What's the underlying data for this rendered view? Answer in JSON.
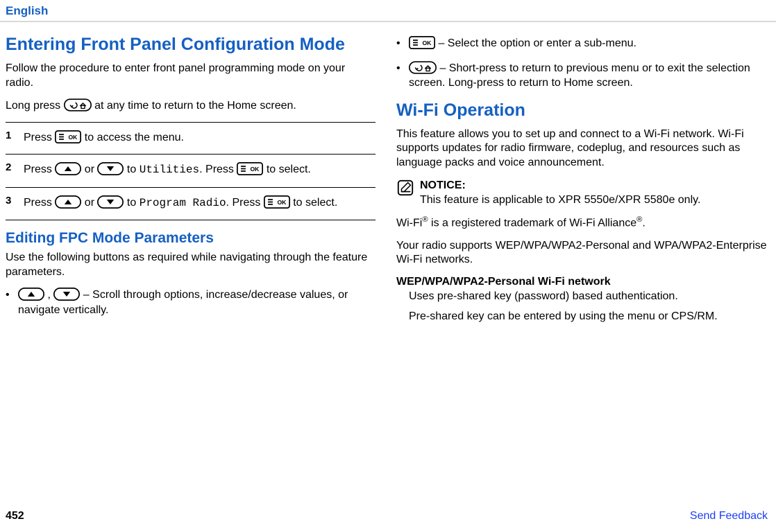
{
  "header": {
    "lang": "English"
  },
  "left": {
    "h1": "Entering Front Panel Configuration Mode",
    "intro": "Follow the procedure to enter front panel programming mode on your radio.",
    "longpress_a": "Long press ",
    "longpress_b": " at any time to return to the Home screen.",
    "steps": [
      {
        "n": "1",
        "a": "Press ",
        "b": " to access the menu."
      },
      {
        "n": "2",
        "a": "Press ",
        "mid": " or ",
        "c": " to ",
        "target": "Utilities",
        "d": ". Press ",
        "e": " to select."
      },
      {
        "n": "3",
        "a": "Press ",
        "mid": " or ",
        "c": " to ",
        "target": "Program Radio",
        "d": ". Press ",
        "e": " to select."
      }
    ],
    "h2": "Editing FPC Mode Parameters",
    "p2": "Use the following buttons as required while navigating through the feature parameters.",
    "b1_a": " , ",
    "b1_b": " – Scroll through options, increase/decrease values, or navigate vertically."
  },
  "right": {
    "b2": " – Select the option or enter a sub-menu.",
    "b3": " – Short-press to return to previous menu or to exit the selection screen. Long-press to return to Home screen.",
    "h1": "Wi-Fi Operation",
    "p1": "This feature allows you to set up and connect to a Wi-Fi network. Wi-Fi supports updates for radio firmware, codeplug, and resources such as language packs and voice announcement.",
    "notice_label": "NOTICE:",
    "notice_text": "This feature is applicable to XPR 5550e/XPR 5580e only.",
    "trademark": "Wi-Fi® is a registered trademark of Wi-Fi Alliance®.",
    "supports": "Your radio supports WEP/WPA/WPA2-Personal and WPA/WPA2-Enterprise Wi-Fi networks.",
    "def_title": "WEP/WPA/WPA2-Personal Wi-Fi network",
    "def_body1": "Uses pre-shared key (password) based authentication.",
    "def_body2": "Pre-shared key can be entered by using the menu or CPS/RM."
  },
  "footer": {
    "page": "452",
    "feedback": "Send Feedback"
  },
  "glyphs": {
    "bullet": "•"
  }
}
